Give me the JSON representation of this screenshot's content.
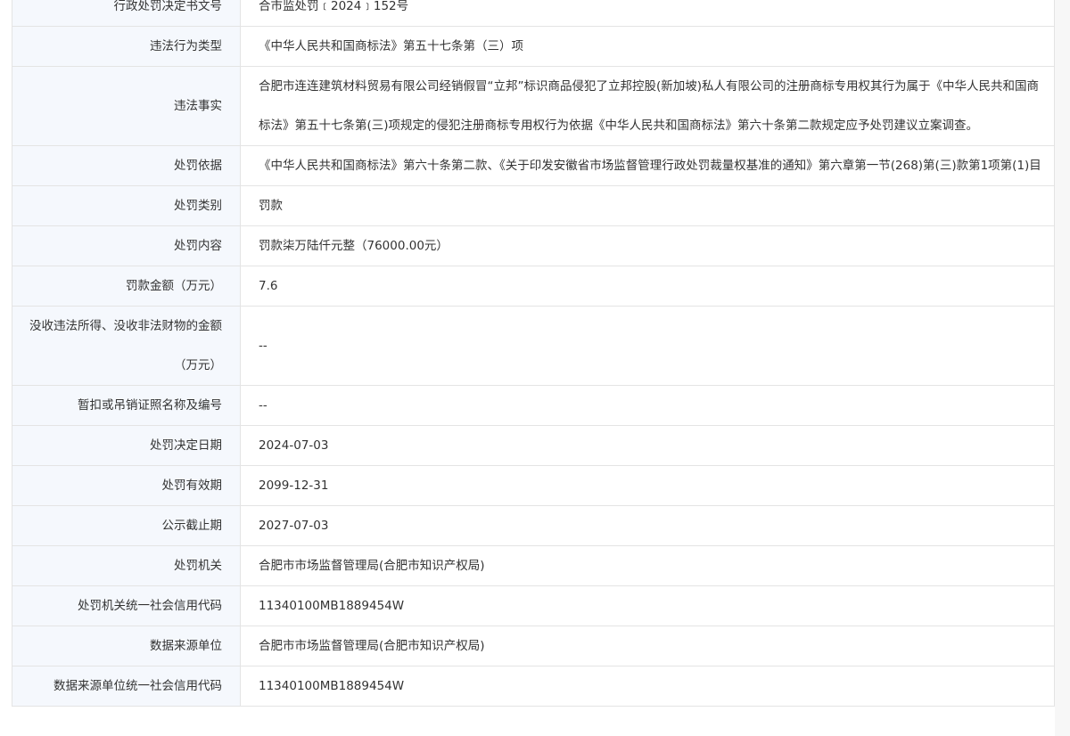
{
  "rows": [
    {
      "label": "行政处罚决定书文号",
      "value": "合市监处罚﹝2024﹞152号"
    },
    {
      "label": "违法行为类型",
      "value": "《中华人民共和国商标法》第五十七条第（三）项"
    },
    {
      "label": "违法事实",
      "value": "合肥市连连建筑材料贸易有限公司经销假冒“立邦”标识商品侵犯了立邦控股(新加坡)私人有限公司的注册商标专用权其行为属于《中华人民共和国商标法》第五十七条第(三)项规定的侵犯注册商标专用权行为依据《中华人民共和国商标法》第六十条第二款规定应予处罚建议立案调查。"
    },
    {
      "label": "处罚依据",
      "value": "《中华人民共和国商标法》第六十条第二款、《关于印发安徽省市场监督管理行政处罚裁量权基准的通知》第六章第一节(268)第(三)款第1项第(1)目"
    },
    {
      "label": "处罚类别",
      "value": "罚款"
    },
    {
      "label": "处罚内容",
      "value": "罚款柒万陆仟元整（76000.00元）"
    },
    {
      "label": "罚款金额（万元）",
      "value": "7.6"
    },
    {
      "label": "没收违法所得、没收非法财物的金额（万元）",
      "value": "--"
    },
    {
      "label": "暂扣或吊销证照名称及编号",
      "value": "--"
    },
    {
      "label": "处罚决定日期",
      "value": "2024-07-03"
    },
    {
      "label": "处罚有效期",
      "value": "2099-12-31"
    },
    {
      "label": "公示截止期",
      "value": "2027-07-03"
    },
    {
      "label": "处罚机关",
      "value": "合肥市市场监督管理局(合肥市知识产权局)"
    },
    {
      "label": "处罚机关统一社会信用代码",
      "value": "11340100MB1889454W"
    },
    {
      "label": "数据来源单位",
      "value": "合肥市市场监督管理局(合肥市知识产权局)"
    },
    {
      "label": "数据来源单位统一社会信用代码",
      "value": "11340100MB1889454W"
    }
  ]
}
